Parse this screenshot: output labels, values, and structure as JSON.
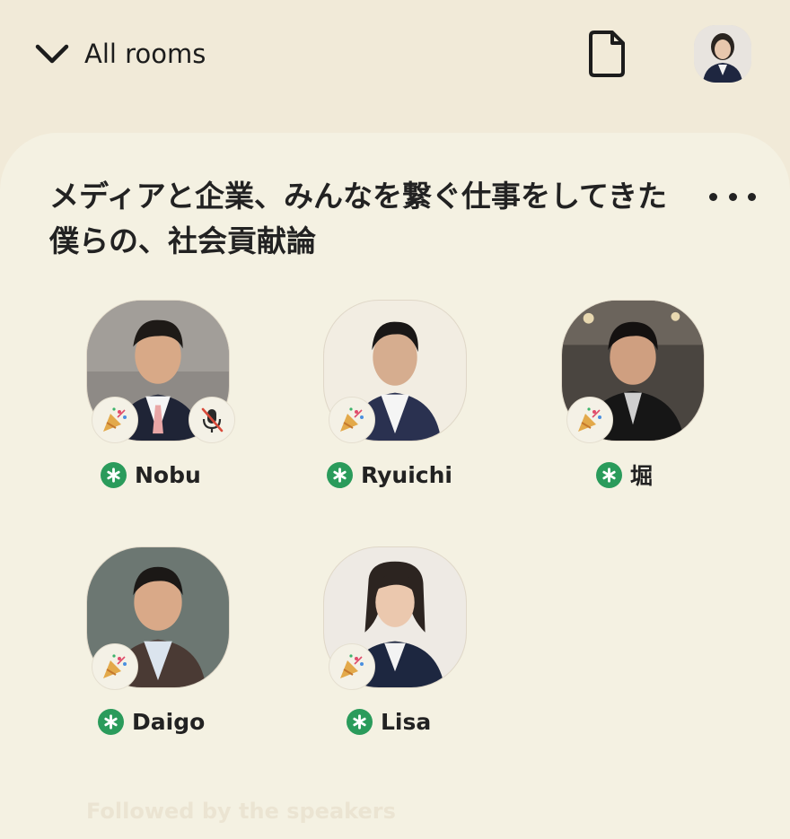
{
  "header": {
    "back_label": "All rooms",
    "back_icon": "chevron-down-icon",
    "document_icon": "document-icon",
    "profile_avatar": "profile-avatar"
  },
  "room": {
    "title": "メディアと企業、みんなを繋ぐ仕事をしてきた僕らの、社会貢献論",
    "more_icon": "more-dots-icon"
  },
  "speakers": [
    {
      "name": "Nobu",
      "badge": "party-popper-icon",
      "muted": true
    },
    {
      "name": "Ryuichi",
      "badge": "party-popper-icon",
      "muted": false
    },
    {
      "name": "堀",
      "badge": "party-popper-icon",
      "muted": false
    },
    {
      "name": "Daigo",
      "badge": "party-popper-icon",
      "muted": false
    },
    {
      "name": "Lisa",
      "badge": "party-popper-icon",
      "muted": false
    }
  ],
  "section_label": "Followed by the speakers",
  "colors": {
    "background": "#f1ead8",
    "card": "#f4f1e2",
    "moderator_green": "#2a9b5b",
    "muted_red": "#d94a3a"
  }
}
